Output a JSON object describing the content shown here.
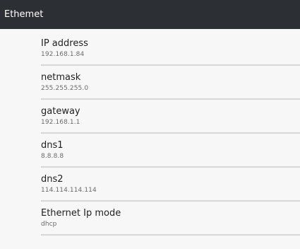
{
  "header": {
    "title": "Ethemet"
  },
  "settings": [
    {
      "title": "IP address",
      "value": "192.168.1.84"
    },
    {
      "title": "netmask",
      "value": "255.255.255.0"
    },
    {
      "title": "gateway",
      "value": "192.168.1.1"
    },
    {
      "title": "dns1",
      "value": "8.8.8.8"
    },
    {
      "title": "dns2",
      "value": "114.114.114.114"
    },
    {
      "title": "Ethernet Ip mode",
      "value": "dhcp"
    }
  ]
}
